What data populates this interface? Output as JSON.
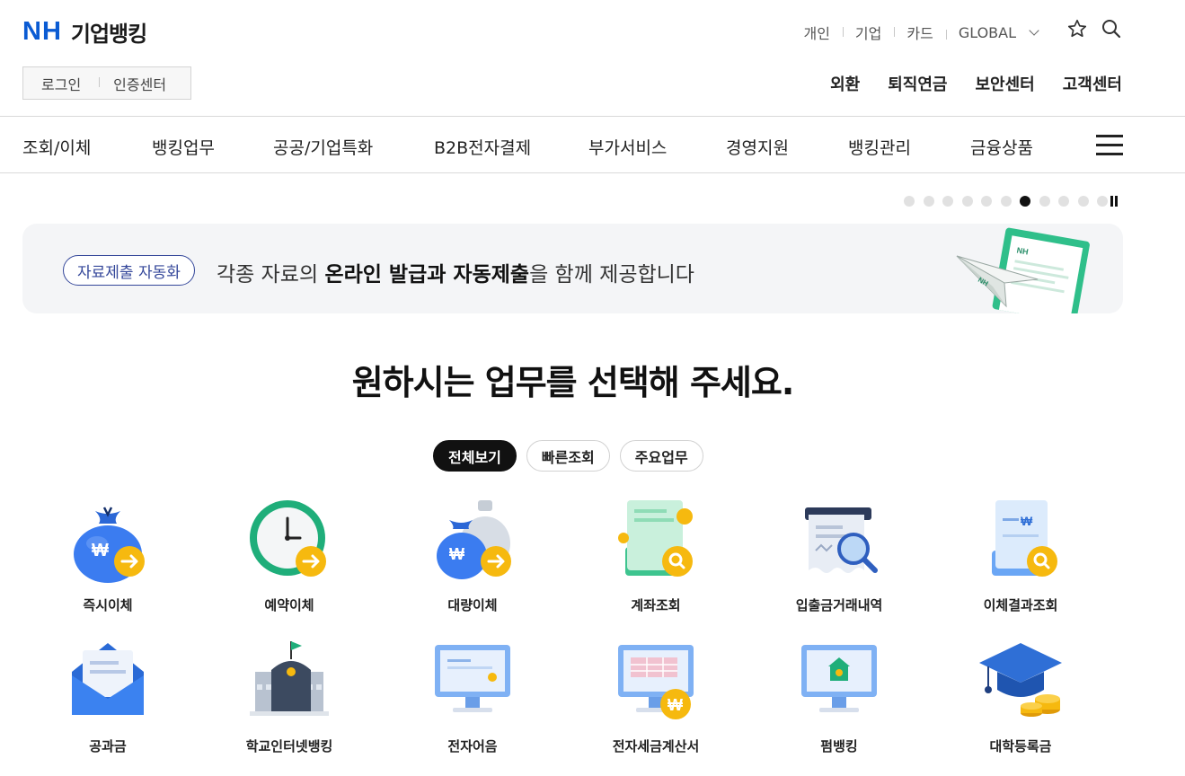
{
  "logo": {
    "brand": "NH",
    "name": "기업뱅킹"
  },
  "top_util": {
    "items": [
      "개인",
      "기업",
      "카드"
    ],
    "global": "GLOBAL"
  },
  "login": {
    "login": "로그인",
    "cert": "인증센터"
  },
  "quick_menu": [
    "외환",
    "퇴직연금",
    "보안센터",
    "고객센터"
  ],
  "gnb": [
    "조회/이체",
    "뱅킹업무",
    "공공/기업특화",
    "B2B전자결제",
    "부가서비스",
    "경영지원",
    "뱅킹관리",
    "금융상품"
  ],
  "slider": {
    "total": 11,
    "active": 7
  },
  "banner": {
    "tag": "자료제출 자동화",
    "text_pre": "각종 자료의 ",
    "text_bold": "온라인 발급과 자동제출",
    "text_post": "을 함께 제공합니다"
  },
  "main_title": "원하시는 업무를 선택해 주세요.",
  "filters": [
    "전체보기",
    "빠른조회",
    "주요업무"
  ],
  "services": [
    {
      "label": "즉시이체",
      "icon": "money-bag-arrow-icon"
    },
    {
      "label": "예약이체",
      "icon": "clock-arrow-icon"
    },
    {
      "label": "대량이체",
      "icon": "multiple-money-bags-arrow-icon"
    },
    {
      "label": "계좌조회",
      "icon": "passbook-search-icon"
    },
    {
      "label": "입출금거래내역",
      "icon": "receipt-search-icon"
    },
    {
      "label": "이체결과조회",
      "icon": "document-search-icon"
    },
    {
      "label": "공과금",
      "icon": "envelope-icon"
    },
    {
      "label": "학교인터넷뱅킹",
      "icon": "school-building-icon"
    },
    {
      "label": "전자어음",
      "icon": "monitor-note-icon"
    },
    {
      "label": "전자세금계산서",
      "icon": "monitor-invoice-icon"
    },
    {
      "label": "펌뱅킹",
      "icon": "monitor-bank-icon"
    },
    {
      "label": "대학등록금",
      "icon": "graduation-cap-coins-icon"
    }
  ],
  "colors": {
    "brand_blue": "#0a5bd3",
    "banner_tag": "#34479a",
    "accent_yellow": "#f6b90f"
  }
}
